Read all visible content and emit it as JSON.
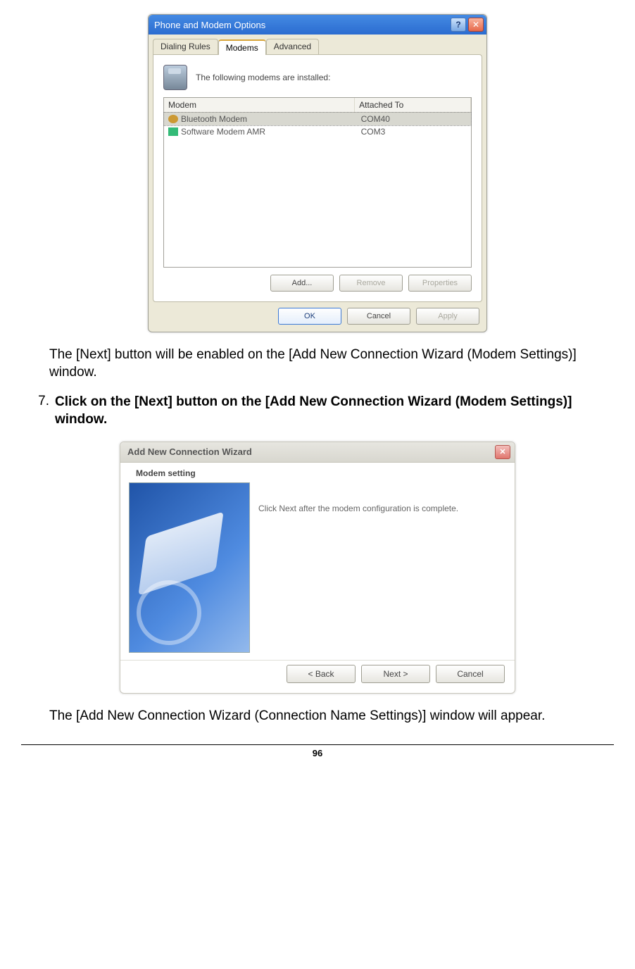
{
  "dlg1": {
    "title": "Phone and Modem Options",
    "tabs": {
      "t0": "Dialing Rules",
      "t1": "Modems",
      "t2": "Advanced"
    },
    "line": "The following modems are  installed:",
    "columns": {
      "c0": "Modem",
      "c1": "Attached To"
    },
    "rows": [
      {
        "name": "Bluetooth Modem",
        "port": "COM40"
      },
      {
        "name": "Software Modem AMR",
        "port": "COM3"
      }
    ],
    "buttons": {
      "add": "Add...",
      "remove": "Remove",
      "props": "Properties",
      "ok": "OK",
      "cancel": "Cancel",
      "apply": "Apply"
    }
  },
  "para1a": "The [Next] button will be enabled on the [Add New Connection Wizard (Modem Settings)] window.",
  "step": {
    "n": "7.",
    "t": "Click on the [Next] button on the [Add New Connection Wizard (Modem Settings)] window."
  },
  "dlg2": {
    "title": "Add New Connection Wizard",
    "subtitle": "Modem setting",
    "body": "Click Next after the modem configuration is complete.",
    "buttons": {
      "back": "< Back",
      "next": "Next >",
      "cancel": "Cancel"
    }
  },
  "para2": "The [Add New Connection Wizard (Connection Name Settings)] window will appear.",
  "pagenum": "96"
}
